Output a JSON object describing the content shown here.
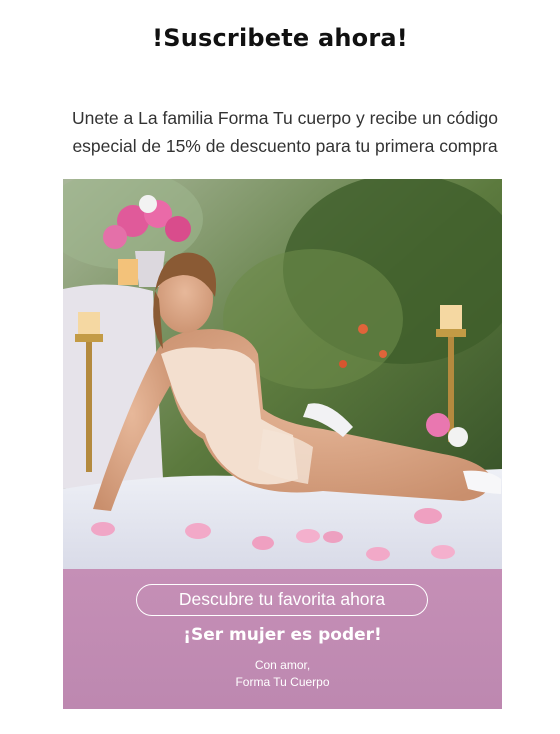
{
  "header": {
    "title": "!Suscribete ahora!"
  },
  "intro": {
    "text": "Unete a La familia Forma Tu cuerpo y recibe un código especial de 15% de descuento para tu primera compra"
  },
  "banner": {
    "cta_label": "Descubre tu favorita ahora",
    "tagline": "¡Ser mujer es poder!",
    "signoff_line1": "Con amor,",
    "signoff_line2": "Forma Tu Cuerpo"
  },
  "colors": {
    "band": "#c58fb6",
    "text_on_band": "#ffffff"
  }
}
